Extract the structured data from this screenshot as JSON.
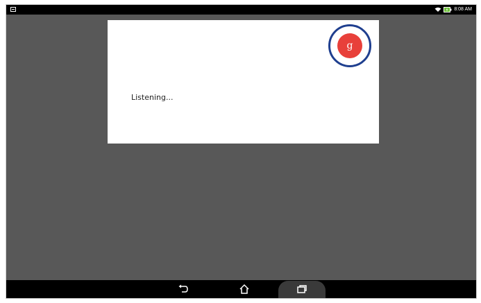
{
  "status_bar": {
    "time": "8:08 AM",
    "icons": [
      "notification-icon",
      "wifi-icon",
      "battery-charging-icon"
    ]
  },
  "dialog": {
    "message": "Listening...",
    "mic_label": "g",
    "mic_color": "#e8403a",
    "highlight_color": "#1f3f8f"
  },
  "nav_bar": {
    "buttons": [
      "back-icon",
      "home-icon",
      "recent-apps-icon"
    ]
  },
  "colors": {
    "background": "#585858",
    "dialog": "#ffffff",
    "bars": "#000000"
  }
}
